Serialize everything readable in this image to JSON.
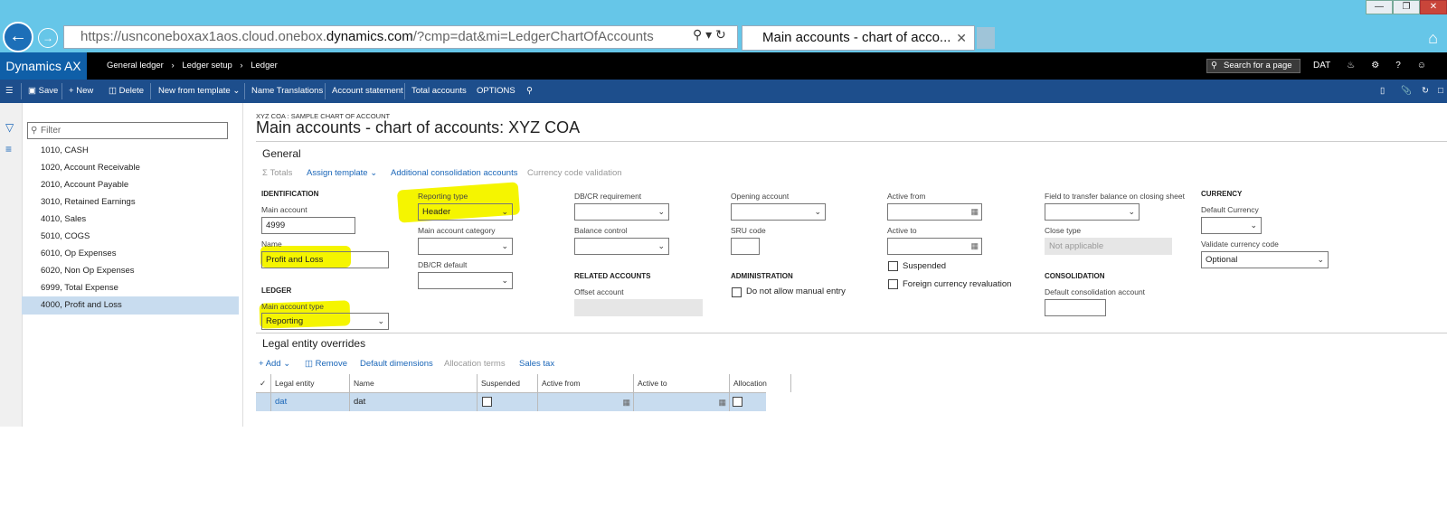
{
  "browser": {
    "url_prefix": "https://usnconeboxax1aos.cloud.onebox.",
    "url_domain": "dynamics.com",
    "url_suffix": "/?cmp=dat&mi=LedgerChartOfAccounts",
    "tab_title": "Main accounts - chart of acco...",
    "window_controls": [
      "—",
      "❐",
      "✕"
    ]
  },
  "appbar": {
    "brand": "Dynamics AX",
    "breadcrumbs": [
      "General ledger",
      "Ledger setup",
      "Ledger"
    ],
    "search_placeholder": "Search for a page",
    "company": "DAT"
  },
  "actions": {
    "save": "Save",
    "new": "New",
    "delete": "Delete",
    "new_from_template": "New from template",
    "name_translations": "Name Translations",
    "account_statement": "Account statement",
    "total_accounts": "Total accounts",
    "options": "OPTIONS"
  },
  "list": {
    "filter_placeholder": "Filter",
    "items": [
      "1010, CASH",
      "1020, Account Receivable",
      "2010, Account Payable",
      "3010, Retained Earnings",
      "4010, Sales",
      "5010, COGS",
      "6010, Op Expenses",
      "6020, Non Op Expenses",
      "6999, Total Expense",
      "4000, Profit and Loss"
    ],
    "selected_index": 9
  },
  "page": {
    "caption": "XYZ COA : SAMPLE CHART OF ACCOUNT",
    "title": "Main accounts - chart of accounts: XYZ COA"
  },
  "general": {
    "section_title": "General",
    "toolbar": {
      "totals": "Totals",
      "assign_template": "Assign template",
      "additional_consolidation": "Additional consolidation accounts",
      "currency_code_validation": "Currency code validation"
    },
    "identification": {
      "header": "IDENTIFICATION",
      "main_account_label": "Main account",
      "main_account_value": "4999",
      "name_label": "Name",
      "name_value": "Profit and Loss"
    },
    "ledger": {
      "header": "LEDGER",
      "main_account_type_label": "Main account type",
      "main_account_type_value": "Reporting"
    },
    "col2": {
      "reporting_type_label": "Reporting type",
      "reporting_type_value": "Header",
      "main_account_category_label": "Main account category",
      "dbcr_default_label": "DB/CR default"
    },
    "col3": {
      "dbcr_requirement_label": "DB/CR requirement",
      "balance_control_label": "Balance control",
      "related_header": "RELATED ACCOUNTS",
      "offset_account_label": "Offset account"
    },
    "col4": {
      "opening_account_label": "Opening account",
      "sru_code_label": "SRU code",
      "admin_header": "ADMINISTRATION",
      "no_manual_entry": "Do not allow manual entry"
    },
    "col5": {
      "active_from_label": "Active from",
      "active_to_label": "Active to",
      "suspended": "Suspended",
      "foreign_currency_reval": "Foreign currency revaluation"
    },
    "col6": {
      "transfer_label": "Field to transfer balance on closing sheet",
      "close_type_label": "Close type",
      "close_type_value": "Not applicable",
      "consolidation_header": "CONSOLIDATION",
      "default_consolidation_label": "Default consolidation account"
    },
    "currency": {
      "header": "CURRENCY",
      "default_currency_label": "Default Currency",
      "validate_label": "Validate currency code",
      "validate_value": "Optional"
    }
  },
  "legal": {
    "section_title": "Legal entity overrides",
    "toolbar": {
      "add": "Add",
      "remove": "Remove",
      "default_dimensions": "Default dimensions",
      "allocation_terms": "Allocation terms",
      "sales_tax": "Sales tax"
    },
    "columns": [
      "Legal entity",
      "Name",
      "Suspended",
      "Active from",
      "Active to",
      "Allocation"
    ],
    "rows": [
      {
        "legal_entity": "dat",
        "name": "dat"
      }
    ]
  }
}
